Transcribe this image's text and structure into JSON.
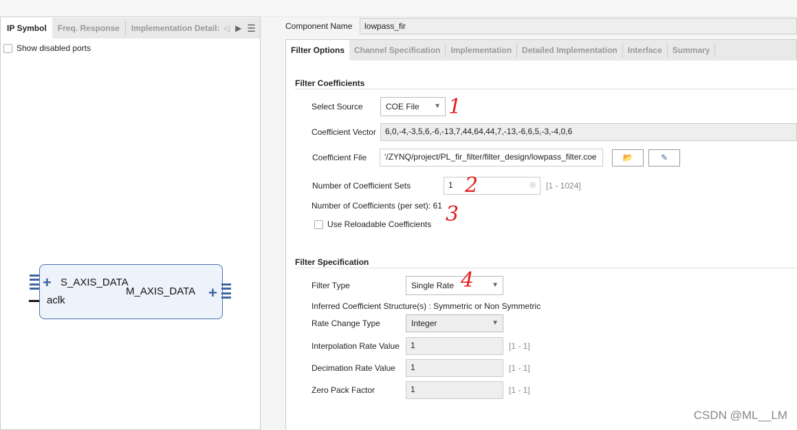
{
  "left_panel": {
    "tabs": [
      "IP Symbol",
      "Freq. Response",
      "Implementation Detail:"
    ],
    "show_disabled_ports": "Show disabled ports",
    "symbol": {
      "ports_left": [
        "S_AXIS_DATA",
        "aclk"
      ],
      "ports_right": [
        "M_AXIS_DATA"
      ]
    }
  },
  "component": {
    "label": "Component Name",
    "value": "lowpass_fir"
  },
  "tabs": [
    "Filter Options",
    "Channel Specification",
    "Implementation",
    "Detailed Implementation",
    "Interface",
    "Summary"
  ],
  "coefficients": {
    "heading": "Filter Coefficients",
    "select_source_label": "Select Source",
    "select_source": "COE File",
    "vector_label": "Coefficient Vector",
    "vector": "6,0,-4,-3,5,6,-6,-13,7,44,64,44,7,-13,-6,6,5,-3,-4,0,6",
    "file_label": "Coefficient File",
    "file": "'/ZYNQ/project/PL_fir_filter/filter_design/lowpass_filter.coe",
    "sets_label": "Number of Coefficient Sets",
    "sets": "1",
    "sets_range": "[1 - 1024]",
    "count_text": "Number of Coefficients (per set): 61",
    "reloadable": "Use Reloadable Coefficients"
  },
  "specification": {
    "heading": "Filter Specification",
    "filter_type_label": "Filter Type",
    "filter_type": "Single Rate",
    "inferred": "Inferred Coefficient Structure(s) : Symmetric or Non Symmetric",
    "rate_change_label": "Rate Change Type",
    "rate_change": "Integer",
    "interp_label": "Interpolation Rate Value",
    "interp": "1",
    "interp_range": "[1 - 1]",
    "decim_label": "Decimation Rate Value",
    "decim": "1",
    "decim_range": "[1 - 1]",
    "zero_label": "Zero Pack Factor",
    "zero": "1",
    "zero_range": "[1 - 1]"
  },
  "annotations": [
    "1",
    "2",
    "3",
    "4"
  ],
  "watermark": "CSDN @ML__LM"
}
